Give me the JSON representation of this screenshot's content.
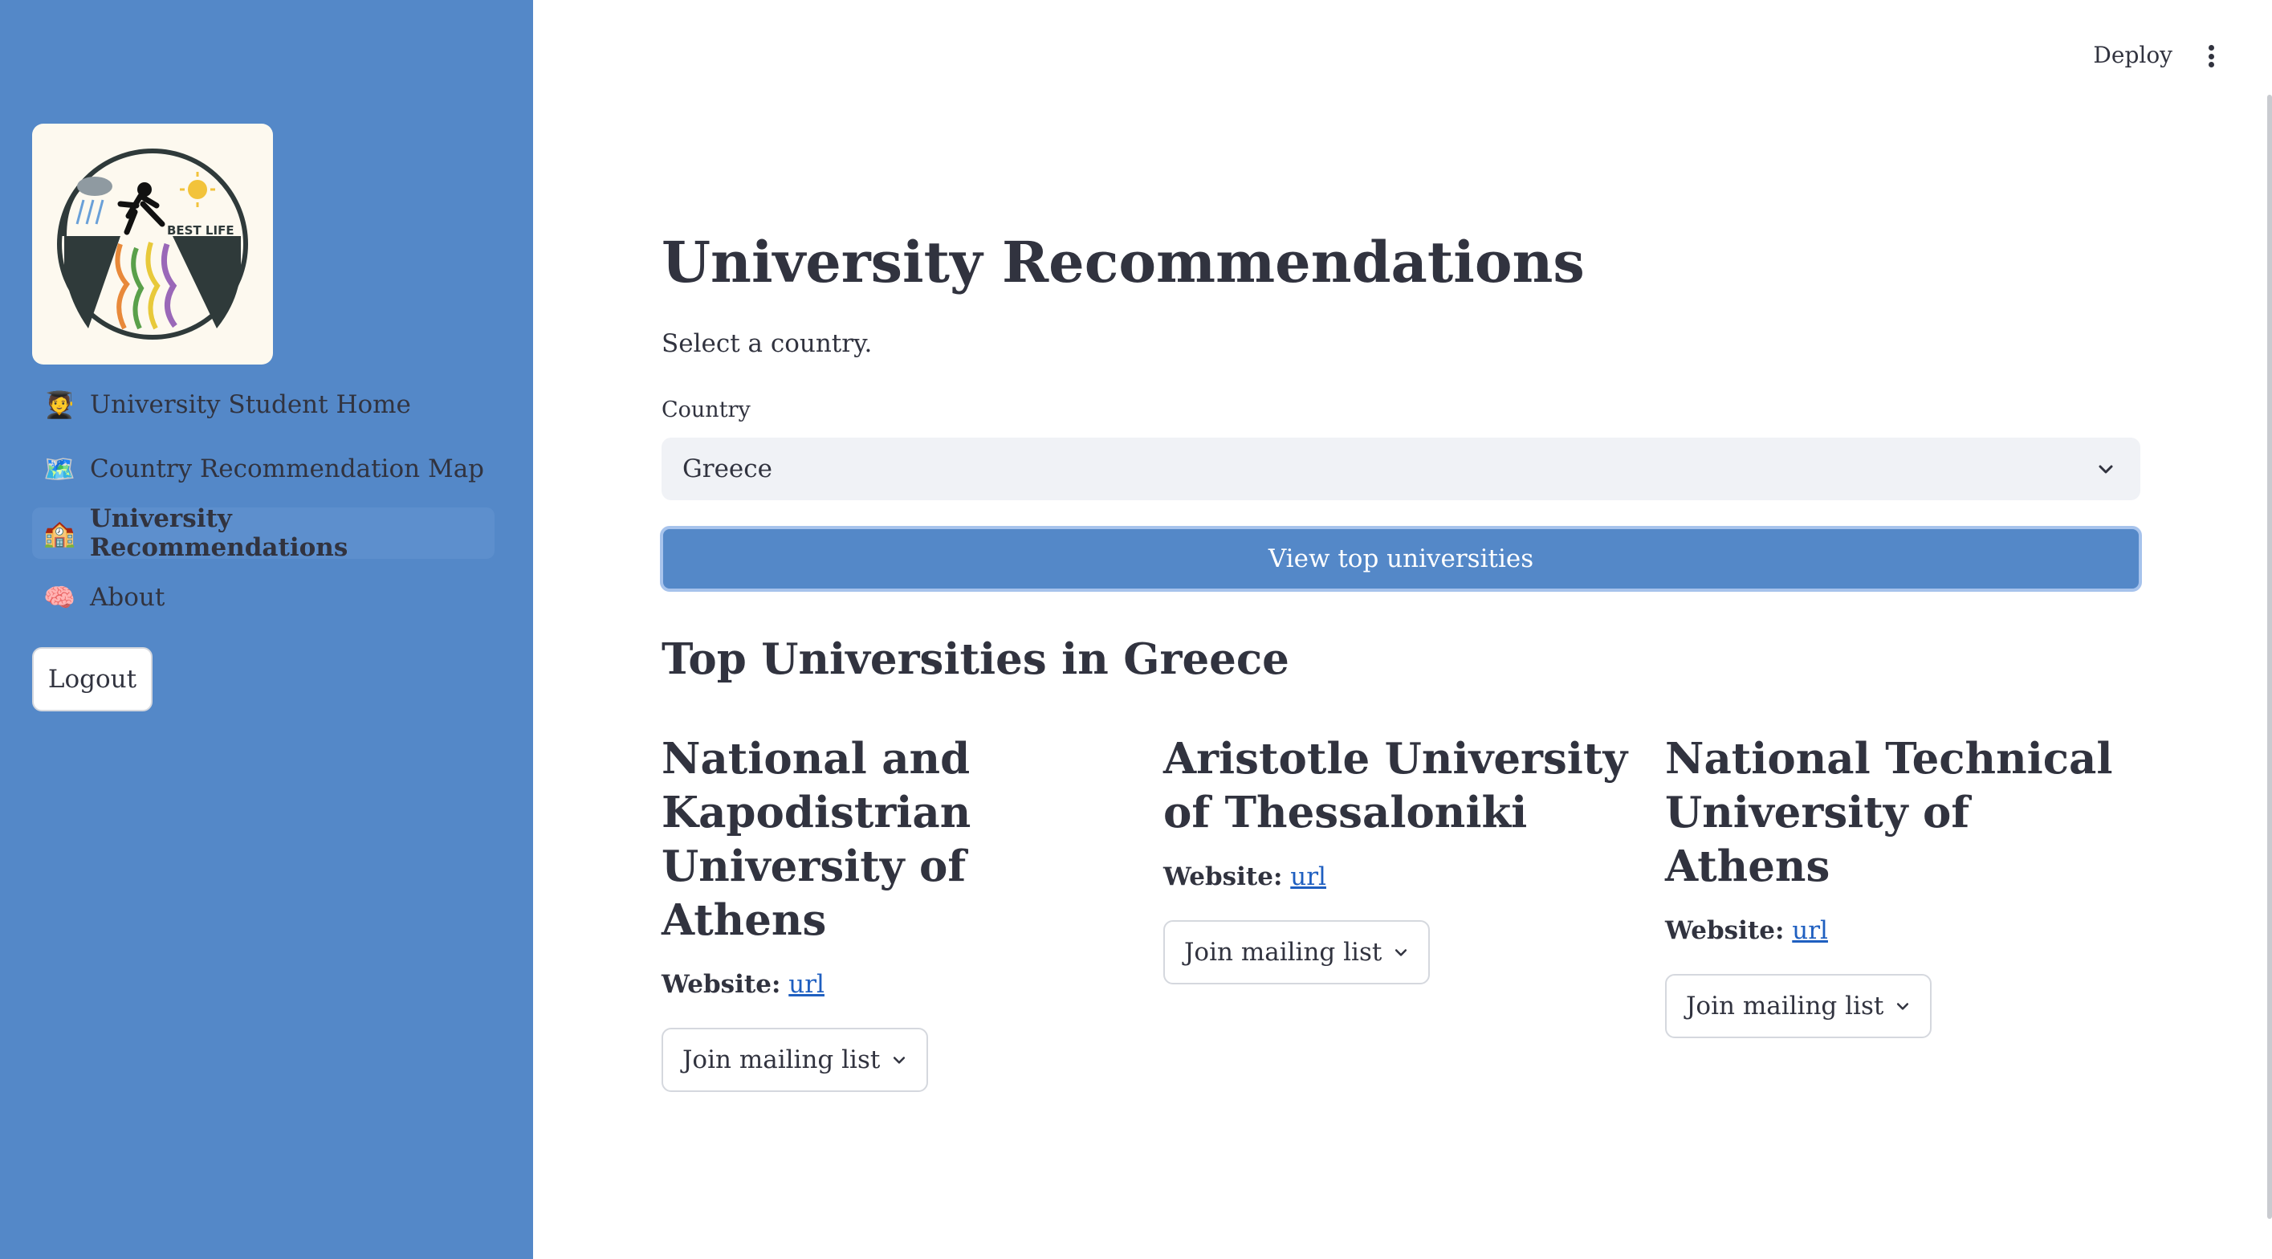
{
  "sidebar": {
    "logo_text": "BEST LIFE",
    "items": [
      {
        "emoji": "🧑‍🎓",
        "label": "University Student Home",
        "active": false
      },
      {
        "emoji": "🗺️",
        "label": "Country Recommendation Map",
        "active": false
      },
      {
        "emoji": "🏫",
        "label": "University Recommendations",
        "active": true
      },
      {
        "emoji": "🧠",
        "label": "About",
        "active": false
      }
    ],
    "logout_label": "Logout"
  },
  "header": {
    "deploy_label": "Deploy"
  },
  "main": {
    "title": "University Recommendations",
    "subtitle": "Select a country.",
    "country_label": "Country",
    "country_value": "Greece",
    "view_button_label": "View top universities",
    "section_title": "Top Universities in Greece",
    "universities": [
      {
        "name": "National and Kapodistrian University of Athens",
        "website_label": "Website:",
        "link_text": "url",
        "mailing_label": "Join mailing list"
      },
      {
        "name": "Aristotle University of Thessaloniki",
        "website_label": "Website:",
        "link_text": "url",
        "mailing_label": "Join mailing list"
      },
      {
        "name": "National Technical University of Athens",
        "website_label": "Website:",
        "link_text": "url",
        "mailing_label": "Join mailing list"
      }
    ]
  },
  "colors": {
    "sidebar_bg": "#5488c8",
    "primary_button": "#5488c8",
    "link": "#1f5fc0",
    "text": "#31333f"
  }
}
